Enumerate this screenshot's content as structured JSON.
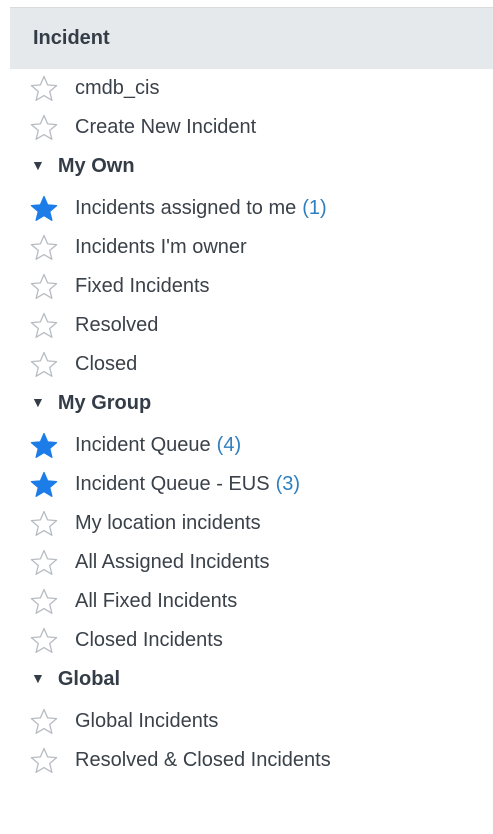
{
  "header": {
    "title": "Incident"
  },
  "colors": {
    "favorite_star": "#1d7de8",
    "empty_star_outline": "#b7bcc2",
    "count": "#2e7fc0",
    "header_bg": "#e6e9eb",
    "text": "#343d47"
  },
  "top_items": [
    {
      "label": "cmdb_cis",
      "icon": "star-outline-icon"
    },
    {
      "label": "Create New Incident",
      "icon": "star-outline-icon"
    }
  ],
  "sections": [
    {
      "title": "My Own",
      "items": [
        {
          "label": "Incidents assigned to me",
          "count": "(1)",
          "icon": "star-filled-icon"
        },
        {
          "label": "Incidents I'm owner",
          "icon": "star-outline-icon"
        },
        {
          "label": "Fixed Incidents",
          "icon": "star-outline-icon"
        },
        {
          "label": "Resolved",
          "icon": "star-outline-icon"
        },
        {
          "label": "Closed",
          "icon": "star-outline-icon"
        }
      ]
    },
    {
      "title": "My Group",
      "items": [
        {
          "label": "Incident Queue",
          "count": "(4)",
          "icon": "star-filled-icon"
        },
        {
          "label": "Incident Queue - EUS",
          "count": "(3)",
          "icon": "star-filled-icon"
        },
        {
          "label": "My location incidents",
          "icon": "star-outline-icon"
        },
        {
          "label": "All Assigned Incidents",
          "icon": "star-outline-icon"
        },
        {
          "label": "All Fixed Incidents",
          "icon": "star-outline-icon"
        },
        {
          "label": "Closed Incidents",
          "icon": "star-outline-icon"
        }
      ]
    },
    {
      "title": "Global",
      "items": [
        {
          "label": "Global Incidents",
          "icon": "star-outline-icon"
        },
        {
          "label": "Resolved & Closed Incidents",
          "icon": "star-outline-icon"
        }
      ]
    }
  ]
}
